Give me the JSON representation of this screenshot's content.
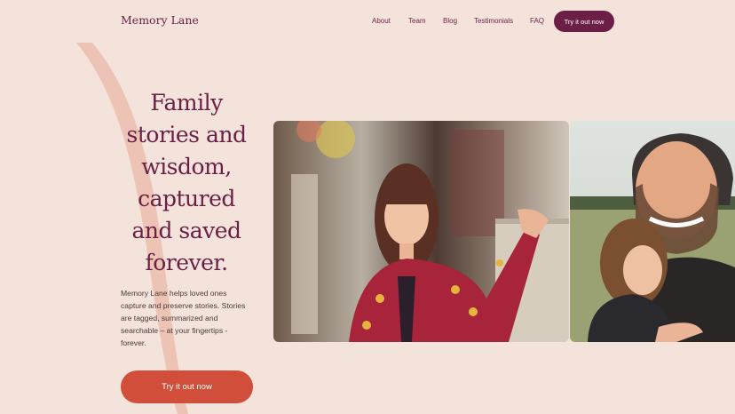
{
  "header": {
    "logo": "Memory Lane",
    "nav": [
      "About",
      "Team",
      "Blog",
      "Testimonials",
      "FAQ"
    ],
    "cta": "Try it out now"
  },
  "hero": {
    "headline": "Family stories and wisdom, captured and saved forever.",
    "description": "Memory Lane helps loved ones capture and preserve stories. Stories are tagged, summarized and searchable – at your fingertips - forever.",
    "cta": "Try it out now"
  },
  "colors": {
    "background": "#f3e3da",
    "brand": "#6b1f46",
    "accent": "#d14e3a",
    "arc": "#ecc3b4"
  }
}
